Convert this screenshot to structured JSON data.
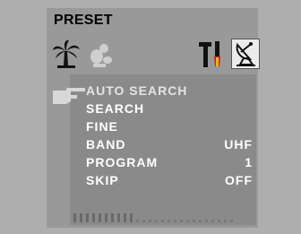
{
  "osd": {
    "title": "PRESET"
  },
  "tabs": [
    {
      "name": "picture",
      "icon": "palm-tree-icon"
    },
    {
      "name": "sound",
      "icon": "sound-icon"
    },
    {
      "name": "setup",
      "icon": "tools-icon"
    },
    {
      "name": "preset",
      "icon": "satellite-dish-icon",
      "active": true
    }
  ],
  "menu": {
    "items": [
      {
        "label": "AUTO SEARCH",
        "value": "",
        "selected": true
      },
      {
        "label": "SEARCH",
        "value": ""
      },
      {
        "label": "FINE",
        "value": ""
      },
      {
        "label": "BAND",
        "value": "UHF"
      },
      {
        "label": "PROGRAM",
        "value": "1"
      },
      {
        "label": "SKIP",
        "value": "OFF"
      }
    ]
  },
  "colors": {
    "background": "#aeaeae",
    "osd": "#999999",
    "panel": "#8a8a8a",
    "text": "#ffffff",
    "title": "#000000"
  }
}
